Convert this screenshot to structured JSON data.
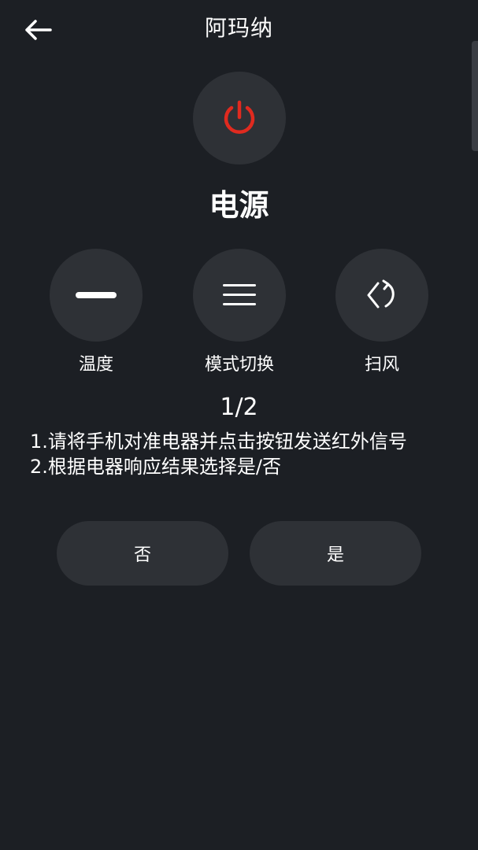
{
  "header": {
    "title": "阿玛纳",
    "back_icon": "arrow-left-icon"
  },
  "power": {
    "label": "电源",
    "icon": "power-icon",
    "icon_color": "#e02a1f"
  },
  "controls": [
    {
      "label": "温度",
      "icon": "minus-icon"
    },
    {
      "label": "模式切换",
      "icon": "menu-icon"
    },
    {
      "label": "扫风",
      "icon": "swing-icon"
    }
  ],
  "progress": "1/2",
  "instructions": [
    "1.请将手机对准电器并点击按钮发送红外信号",
    "2.根据电器响应结果选择是/否"
  ],
  "buttons": {
    "no_label": "否",
    "yes_label": "是"
  },
  "colors": {
    "background": "#1c1f24",
    "button_bg": "#2e3136",
    "accent": "#e02a1f"
  }
}
